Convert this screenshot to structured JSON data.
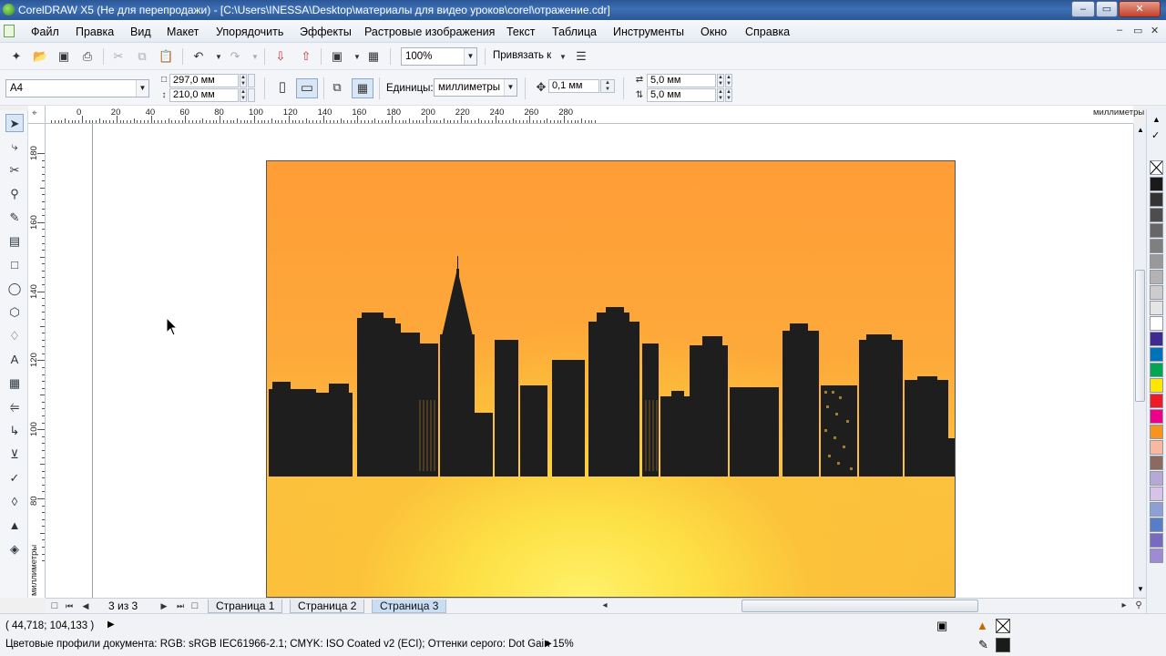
{
  "window": {
    "title": "CorelDRAW X5 (Не для перепродажи) - [C:\\Users\\INESSA\\Desktop\\материалы для видео уроков\\corel\\отражение.cdr]",
    "controls": [
      "–",
      "▭",
      "✕"
    ]
  },
  "menu": {
    "items": [
      "Файл",
      "Правка",
      "Вид",
      "Макет",
      "Упорядочить",
      "Эффекты",
      "Растровые изображения",
      "Текст",
      "Таблица",
      "Инструменты",
      "Окно",
      "Справка"
    ],
    "doc_controls": [
      "–",
      "▭",
      "✕"
    ]
  },
  "standard_toolbar": {
    "zoom_value": "100%",
    "snap_label": "Привязать к"
  },
  "property_bar": {
    "page_size": "A4",
    "width": "297,0 мм",
    "height": "210,0 мм",
    "units_label": "Единицы:",
    "units_value": "миллиметры",
    "nudge": "0,1 мм",
    "dup_x": "5,0 мм",
    "dup_y": "5,0 мм"
  },
  "ruler": {
    "unit_label": "миллиметры",
    "h_labels": [
      "0",
      "20",
      "40",
      "60",
      "80",
      "100",
      "120",
      "140",
      "160",
      "180",
      "200",
      "220",
      "240",
      "260",
      "280"
    ],
    "v_labels": [
      "180",
      "160",
      "140",
      "120",
      "100",
      "80"
    ],
    "v_unit_label": "миллиметры"
  },
  "page_nav": {
    "counter": "3 из 3",
    "tabs": [
      "Страница 1",
      "Страница 2",
      "Страница 3"
    ],
    "active_tab": 2
  },
  "status": {
    "coords": "( 44,718; 104,133 )",
    "color_profiles": "Цветовые профили документа: RGB: sRGB IEC61966-2.1; CMYK: ISO Coated v2 (ECI); Оттенки серого: Dot Gain 15%"
  },
  "colors": {
    "palette": [
      "#ffffff",
      "#1a1a1a",
      "#333333",
      "#4d4d4d",
      "#666666",
      "#7f7f7f",
      "#999999",
      "#b3b3b3",
      "#cccccc",
      "#e5e5e5",
      "#ffffff",
      "#3f2a8f",
      "#0072bc",
      "#00a651",
      "#ffe600",
      "#ed1c24",
      "#ec008c",
      "#f7941d",
      "#f9b9a0",
      "#8c6a5e",
      "#b7a9d6",
      "#d7c3e8",
      "#8e9fd6",
      "#5a7dc9",
      "#7a6abf",
      "#9f8bd4"
    ],
    "skyline": "#1e1e1e",
    "menu_accent": "#2b5797"
  }
}
